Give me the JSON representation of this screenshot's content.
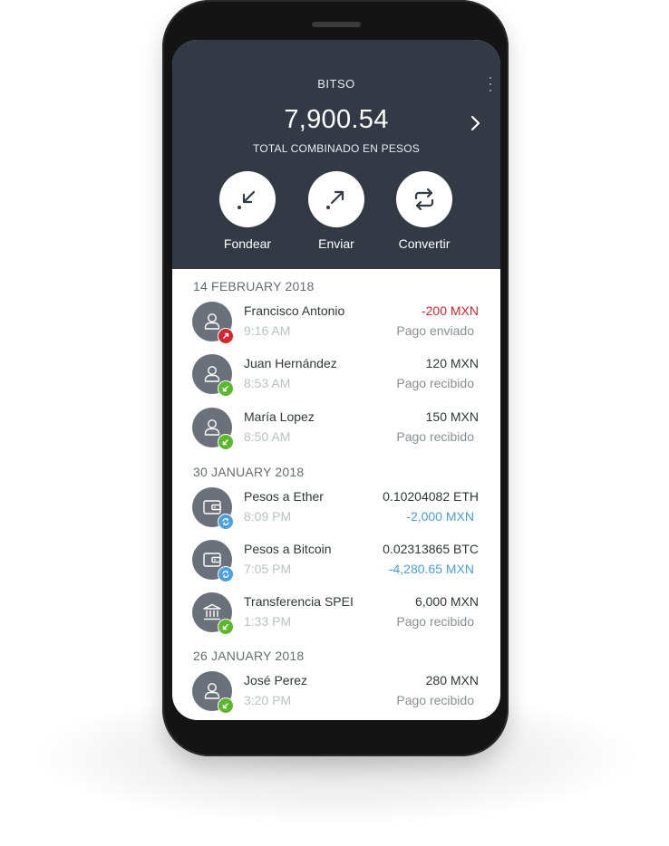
{
  "app": {
    "title": "BITSO"
  },
  "balance": {
    "amount": "7,900.54",
    "label": "TOTAL COMBINADO EN PESOS"
  },
  "actions": [
    {
      "label": "Fondear",
      "icon": "arrow-down-left-icon"
    },
    {
      "label": "Enviar",
      "icon": "arrow-up-right-icon"
    },
    {
      "label": "Convertir",
      "icon": "swap-arrows-icon"
    }
  ],
  "groups": [
    {
      "date": "14 FEBRUARY 2018",
      "items": [
        {
          "name": "Francisco Antonio",
          "time": "9:16 AM",
          "amount": "-200 MXN",
          "status": "Pago enviado",
          "avatar": "person-icon",
          "badge": "sent-badge-icon"
        },
        {
          "name": "Juan Hernández",
          "time": "8:53 AM",
          "amount": "120 MXN",
          "status": "Pago recibido",
          "avatar": "person-icon",
          "badge": "received-badge-icon"
        },
        {
          "name": "María Lopez",
          "time": "8:50 AM",
          "amount": "150 MXN",
          "status": "Pago recibido",
          "avatar": "person-icon",
          "badge": "received-badge-icon"
        }
      ]
    },
    {
      "date": "30 JANUARY 2018",
      "items": [
        {
          "name": "Pesos a Ether",
          "time": "8:09 PM",
          "amount": "0.10204082 ETH",
          "status": "-2,000 MXN",
          "avatar": "wallet-icon",
          "badge": "convert-badge-icon"
        },
        {
          "name": "Pesos a Bitcoin",
          "time": "7:05 PM",
          "amount": "0.02313865 BTC",
          "status": "-4,280.65 MXN",
          "avatar": "wallet-icon",
          "badge": "convert-badge-icon"
        },
        {
          "name": "Transferencia SPEI",
          "time": "1:33 PM",
          "amount": "6,000 MXN",
          "status": "Pago recibido",
          "avatar": "bank-icon",
          "badge": "received-badge-icon"
        }
      ]
    },
    {
      "date": "26 JANUARY 2018",
      "items": [
        {
          "name": "José Perez",
          "time": "3:20 PM",
          "amount": "280 MXN",
          "status": "Pago recibido",
          "avatar": "person-icon",
          "badge": "received-badge-icon"
        }
      ]
    }
  ],
  "colors": {
    "header_bg": "#333a46",
    "negative": "#d3262c",
    "received": "#5bb82b",
    "convert": "#4b9fdc",
    "sent": "#d3262c"
  }
}
